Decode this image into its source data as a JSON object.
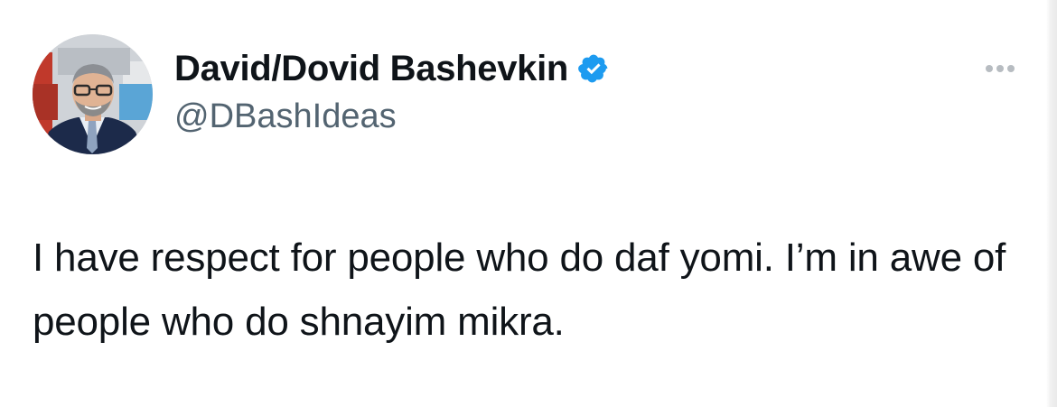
{
  "author": {
    "display_name": "David/Dovid Bashevkin",
    "handle": "@DBashIdeas",
    "verified": true,
    "verified_color": "#1d9bf0",
    "avatar_icon": "profile-photo"
  },
  "tweet": {
    "text": "I have respect for people who do daf yomi. I’m in awe of people who do shnayim mikra."
  },
  "icons": {
    "more": "more-options-icon",
    "verified": "verified-badge-icon"
  },
  "colors": {
    "text": "#0f1419",
    "secondary_text": "#536471",
    "more_dots": "#b7bcc1",
    "background": "#ffffff"
  }
}
